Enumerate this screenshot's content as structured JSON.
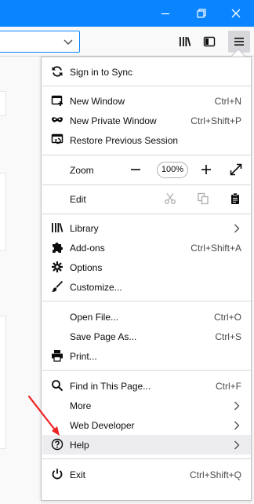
{
  "colors": {
    "titlebar": "#0a84ff",
    "annotation": "#e22"
  },
  "window": {
    "minimize_icon": "minimize-icon",
    "restore_icon": "restore-icon",
    "close_icon": "close-icon"
  },
  "toolbar": {
    "library_icon": "library-icon",
    "sidebar_icon": "sidebar-icon",
    "menu_icon": "hamburger-menu-icon"
  },
  "menu": {
    "sync": {
      "label": "Sign in to Sync"
    },
    "new_window": {
      "label": "New Window",
      "shortcut": "Ctrl+N"
    },
    "new_private": {
      "label": "New Private Window",
      "shortcut": "Ctrl+Shift+P"
    },
    "restore_session": {
      "label": "Restore Previous Session"
    },
    "zoom": {
      "label": "Zoom",
      "value": "100%"
    },
    "edit": {
      "label": "Edit"
    },
    "library": {
      "label": "Library"
    },
    "addons": {
      "label": "Add-ons",
      "shortcut": "Ctrl+Shift+A"
    },
    "options": {
      "label": "Options"
    },
    "customize": {
      "label": "Customize..."
    },
    "open_file": {
      "label": "Open File...",
      "shortcut": "Ctrl+O"
    },
    "save_page": {
      "label": "Save Page As...",
      "shortcut": "Ctrl+S"
    },
    "print": {
      "label": "Print..."
    },
    "find": {
      "label": "Find in This Page...",
      "shortcut": "Ctrl+F"
    },
    "more": {
      "label": "More"
    },
    "web_developer": {
      "label": "Web Developer"
    },
    "help": {
      "label": "Help"
    },
    "exit": {
      "label": "Exit",
      "shortcut": "Ctrl+Shift+Q"
    }
  }
}
